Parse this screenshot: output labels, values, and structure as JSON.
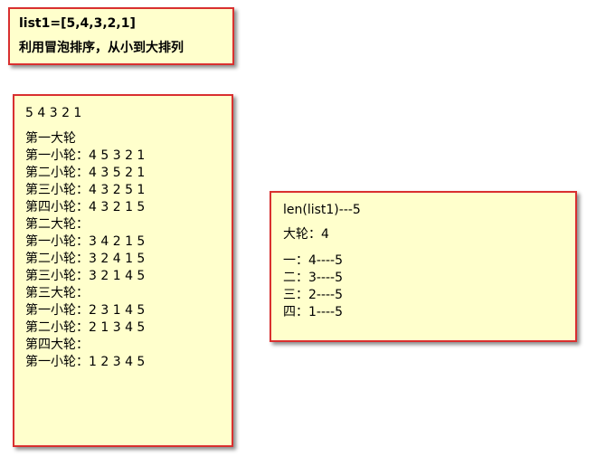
{
  "top_note": {
    "line1": "list1=[5,4,3,2,1]",
    "line2": "利用冒泡排序，从小到大排列"
  },
  "left_note": {
    "initial": "5 4 3 2 1",
    "rounds": [
      {
        "title": "第一大轮",
        "steps": [
          "第一小轮：4 5 3 2 1",
          "第二小轮：4 3 5 2 1",
          "第三小轮：4 3 2 5 1",
          "第四小轮：4 3 2 1 5"
        ]
      },
      {
        "title": "第二大轮：",
        "steps": [
          "第一小轮：3 4 2 1 5",
          "第二小轮：3 2 4 1 5",
          "第三小轮：3 2 1 4 5"
        ]
      },
      {
        "title": "第三大轮：",
        "steps": [
          "第一小轮：2 3 1 4 5",
          "第二小轮：2 1 3 4 5"
        ]
      },
      {
        "title": "第四大轮：",
        "steps": [
          "第一小轮：1 2 3 4 5"
        ]
      }
    ]
  },
  "right_note": {
    "line1": "len(list1)---5",
    "line2": "大轮：4",
    "items": [
      "一：4----5",
      "二：3----5",
      "三：2----5",
      "四：1----5"
    ]
  },
  "colors": {
    "note_background": "#ffffcc",
    "note_border": "#d93030"
  }
}
